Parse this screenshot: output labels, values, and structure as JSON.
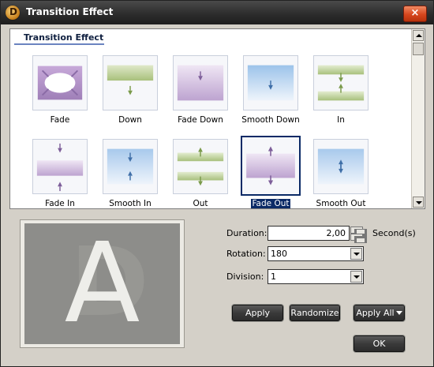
{
  "window": {
    "title": "Transition Effect",
    "close_label": "×",
    "app_icon_letter": "D"
  },
  "gallery": {
    "header": "Transition Effect",
    "effects": [
      {
        "label": "Fade",
        "icon": "fade-icon"
      },
      {
        "label": "Down",
        "icon": "down-icon"
      },
      {
        "label": "Fade Down",
        "icon": "fade-down-icon"
      },
      {
        "label": "Smooth Down",
        "icon": "smooth-down-icon"
      },
      {
        "label": "In",
        "icon": "in-icon"
      },
      {
        "label": "Fade In",
        "icon": "fade-in-icon"
      },
      {
        "label": "Smooth In",
        "icon": "smooth-in-icon"
      },
      {
        "label": "Out",
        "icon": "out-icon"
      },
      {
        "label": "Fade Out",
        "icon": "fade-out-icon",
        "selected": true
      },
      {
        "label": "Smooth Out",
        "icon": "smooth-out-icon"
      }
    ]
  },
  "preview": {
    "letter": "A",
    "watermark_letter": "D"
  },
  "settings": {
    "duration": {
      "label": "Duration:",
      "value": "2,00",
      "unit": "Second(s)"
    },
    "rotation": {
      "label": "Rotation:",
      "value": "180"
    },
    "division": {
      "label": "Division:",
      "value": "1"
    }
  },
  "buttons": {
    "apply": "Apply",
    "randomize": "Randomize",
    "apply_all": "Apply All",
    "ok": "OK"
  },
  "colors": {
    "purple": "#a98fc0",
    "green": "#a7bd7a",
    "blue": "#6f9ed4",
    "selection": "#0b2a66"
  }
}
